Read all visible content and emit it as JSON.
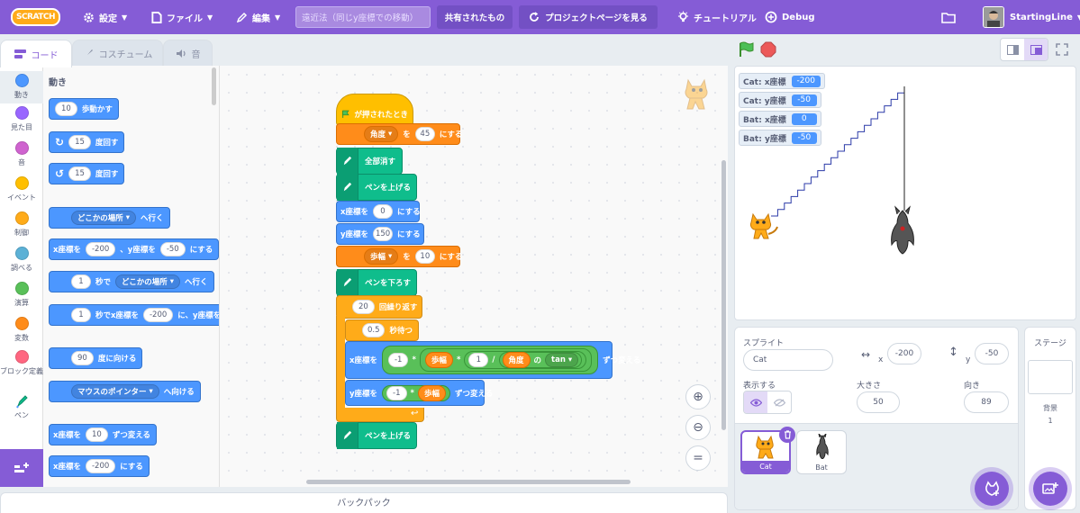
{
  "menubar": {
    "logo_text": "SCRATCH",
    "settings_label": "設定",
    "file_label": "ファイル",
    "edit_label": "編集",
    "project_title": "遠近法（同じy座標での移動）",
    "shared_label": "共有されたもの",
    "project_page_label": "プロジェクトページを見る",
    "tutorial_label": "チュートリアル",
    "debug_label": "Debug",
    "username": "StartingLine"
  },
  "tabs": {
    "code": "コード",
    "costume": "コスチューム",
    "sound": "音"
  },
  "categories": [
    {
      "label": "動き",
      "color": "#4c97ff"
    },
    {
      "label": "見た目",
      "color": "#9966ff"
    },
    {
      "label": "音",
      "color": "#cf63cf"
    },
    {
      "label": "イベント",
      "color": "#ffbf00"
    },
    {
      "label": "制御",
      "color": "#ffab19"
    },
    {
      "label": "調べる",
      "color": "#5cb1d6"
    },
    {
      "label": "演算",
      "color": "#59c059"
    },
    {
      "label": "変数",
      "color": "#ff8c1a"
    },
    {
      "label": "ブロック定義",
      "color": "#ff6680"
    },
    {
      "label": "ペン",
      "color": "#0fbd8c"
    }
  ],
  "palette": {
    "title": "動き",
    "move_val": "10",
    "move_label": "歩動かす",
    "turn_r_val": "15",
    "turn_r_label": "度回す",
    "turn_l_val": "15",
    "turn_l_label": "度回す",
    "goto_dd": "どこかの場所",
    "goto_label": "へ行く",
    "gotoxy_x_label": "x座標を",
    "gotoxy_x": "-200",
    "gotoxy_y_label": "、y座標を",
    "gotoxy_y": "-50",
    "gotoxy_end": "にする",
    "glide_val": "1",
    "glide_label": "秒で",
    "glide_dd": "どこかの場所",
    "glide_end": "へ行く",
    "glidexy_val": "1",
    "glidexy_label": "秒でx座標を",
    "glidexy_x": "-200",
    "glidexy_mid": "に、y座標を",
    "point_val": "90",
    "point_label": "度に向ける",
    "pointto_dd": "マウスのポインター",
    "pointto_label": "へ向ける",
    "changex_label": "x座標を",
    "changex_val": "10",
    "changex_end": "ずつ変える",
    "setx_label": "x座標を",
    "setx_val": "-200",
    "setx_end": "にする"
  },
  "script": {
    "hat": "が押されたとき",
    "set_angle_dd": "角度",
    "set_angle_to": "を",
    "set_angle_val": "45",
    "set_angle_end": "にする",
    "clear": "全部消す",
    "penup1": "ペンを上げる",
    "setx_label": "x座標を",
    "setx_val": "0",
    "setx_end": "にする",
    "sety_label": "y座標を",
    "sety_val": "150",
    "sety_end": "にする",
    "set_step_dd": "歩幅",
    "set_step_to": "を",
    "set_step_val": "10",
    "set_step_end": "にする",
    "pendown": "ペンを下ろす",
    "repeat_val": "20",
    "repeat_label": "回繰り返す",
    "wait_val": "0.5",
    "wait_label": "秒待つ",
    "changex_label": "x座標を",
    "changex_neg": "-1",
    "mul1": "*",
    "step1": "歩幅",
    "mul2": "*",
    "one": "1",
    "div": "/",
    "angle": "角度",
    "of": "の",
    "tan": "tan",
    "changex_end": "ずつ変える",
    "changey_label": "y座標を",
    "changey_neg": "-1",
    "mul3": "*",
    "step2": "歩幅",
    "changey_end": "ずつ変える",
    "penup2": "ペンを上げる"
  },
  "backpack_label": "バックパック",
  "monitors": [
    {
      "label": "Cat: x座標",
      "value": "-200"
    },
    {
      "label": "Cat: y座標",
      "value": "-50"
    },
    {
      "label": "Bat: x座標",
      "value": "0"
    },
    {
      "label": "Bat: y座標",
      "value": "-50"
    }
  ],
  "sprite_info": {
    "sprite_label": "スプライト",
    "sprite_name": "Cat",
    "x_label": "x",
    "x_value": "-200",
    "y_label": "y",
    "y_value": "-50",
    "show_label": "表示する",
    "size_label": "大きさ",
    "size_value": "50",
    "direction_label": "向き",
    "direction_value": "89"
  },
  "sprites": [
    {
      "name": "Cat"
    },
    {
      "name": "Bat"
    }
  ],
  "stage_pane": {
    "title": "ステージ",
    "backdrop_label": "背景",
    "backdrop_count": "1"
  }
}
